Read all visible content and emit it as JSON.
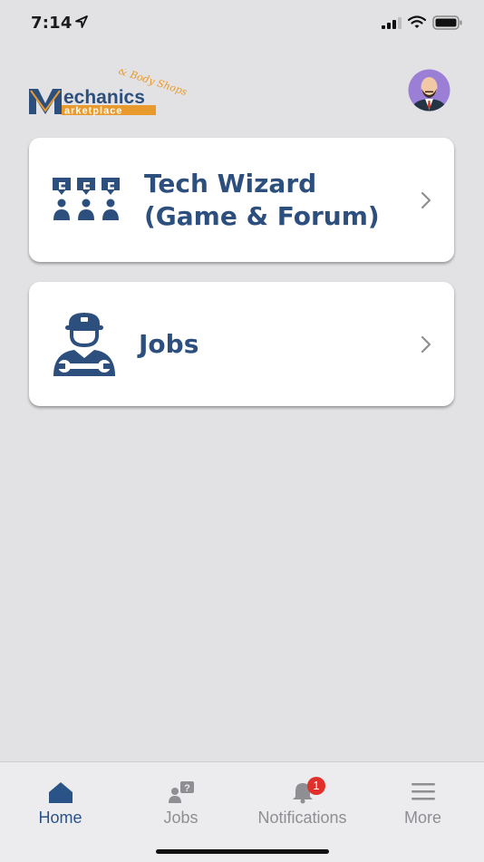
{
  "status_bar": {
    "time": "7:14"
  },
  "header": {
    "logo": {
      "line1": "echanics",
      "line2": "arketplace",
      "tagline": "& Body Shops"
    }
  },
  "cards": [
    {
      "title_line1": "Tech Wizard",
      "title_line2": "(Game & Forum)",
      "icon": "group-chat-icon"
    },
    {
      "title": "Jobs",
      "icon": "mechanic-icon"
    }
  ],
  "tab_bar": {
    "tabs": [
      {
        "label": "Home",
        "icon": "home-icon",
        "active": true
      },
      {
        "label": "Jobs",
        "icon": "jobs-question-icon"
      },
      {
        "label": "Notifications",
        "icon": "bell-icon",
        "badge": "1"
      },
      {
        "label": "More",
        "icon": "hamburger-icon"
      }
    ]
  },
  "colors": {
    "accent": "#2d4f7e",
    "badge": "#e0302b",
    "logo_orange": "#e89a2c"
  }
}
